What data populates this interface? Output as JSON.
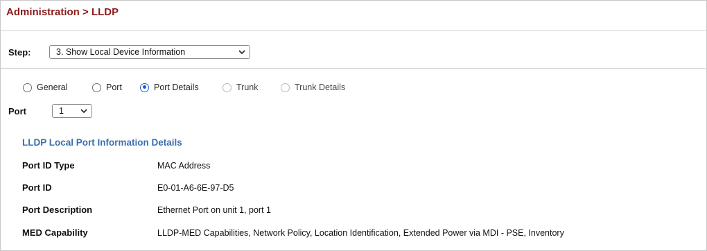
{
  "breadcrumb": "Administration > LLDP",
  "step": {
    "label": "Step:",
    "selected": "3. Show Local Device Information"
  },
  "view_options": [
    {
      "label": "General",
      "checked": false
    },
    {
      "label": "Port",
      "checked": false
    },
    {
      "label": "Port Details",
      "checked": true
    },
    {
      "label": "Trunk",
      "checked": false
    },
    {
      "label": "Trunk Details",
      "checked": false
    }
  ],
  "port": {
    "label": "Port",
    "selected": "1"
  },
  "details": {
    "title": "LLDP Local Port Information Details",
    "rows": [
      {
        "label": "Port ID Type",
        "value": "MAC Address"
      },
      {
        "label": "Port ID",
        "value": "E0-01-A6-6E-97-D5"
      },
      {
        "label": "Port Description",
        "value": "Ethernet Port on unit 1, port 1"
      },
      {
        "label": "MED Capability",
        "value": "LLDP-MED Capabilities, Network Policy, Location Identification, Extended Power via MDI - PSE, Inventory"
      }
    ]
  },
  "colors": {
    "title": "#8b1a1a",
    "section": "#3a6fb0",
    "radio_accent": "#1a5fd1"
  }
}
